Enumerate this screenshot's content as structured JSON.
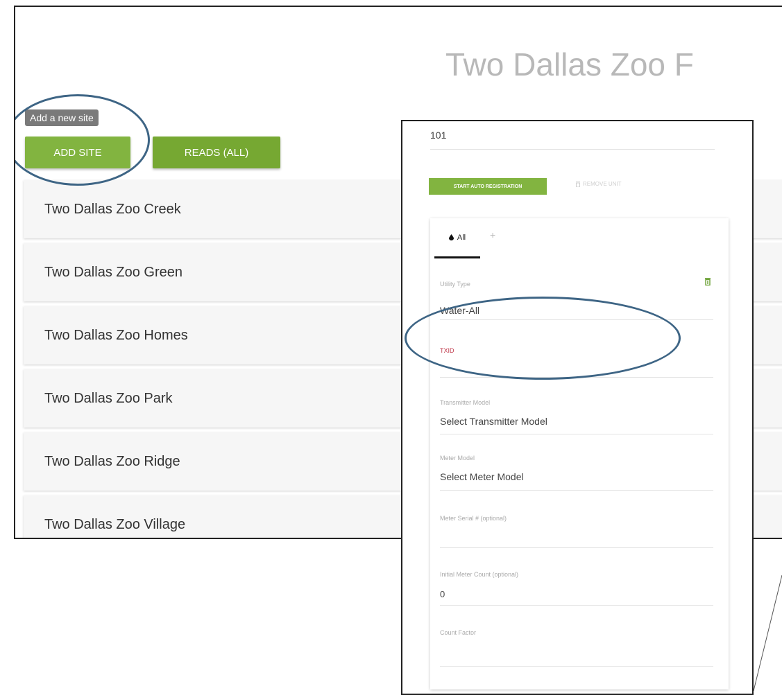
{
  "header": {
    "title": "Two Dallas Zoo F"
  },
  "tooltip": "Add a new site",
  "buttons": {
    "add_site": "ADD SITE",
    "reads_all": "READS (ALL)"
  },
  "sites": [
    "Two Dallas Zoo Creek",
    "Two Dallas Zoo Green",
    "Two Dallas Zoo Homes",
    "Two Dallas Zoo Park",
    "Two Dallas Zoo Ridge",
    "Two Dallas Zoo Village"
  ],
  "unit_form": {
    "unit_number": "101",
    "start_auto_registration": "START AUTO REGISTRATION",
    "remove_unit": "REMOVE UNIT",
    "tabs": {
      "all": "All",
      "add": "+"
    },
    "utility_type": {
      "label": "Utility Type",
      "value": "Water-All"
    },
    "txid": {
      "label": "TXID",
      "value": ""
    },
    "transmitter_model": {
      "label": "Transmitter Model",
      "value": "Select Transmitter Model"
    },
    "meter_model": {
      "label": "Meter Model",
      "value": "Select Meter Model"
    },
    "meter_serial": {
      "label": "Meter Serial # (optional)",
      "value": ""
    },
    "initial_meter_count": {
      "label": "Initial Meter Count (optional)",
      "value": "0"
    },
    "count_factor": {
      "label": "Count Factor",
      "value": ""
    }
  },
  "colors": {
    "accent_green": "#82b440",
    "annotation_circle": "#3e6585",
    "txid_label": "#c0394b"
  }
}
